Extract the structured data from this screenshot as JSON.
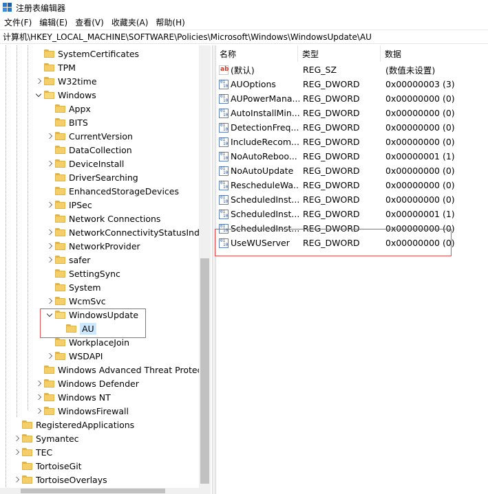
{
  "window": {
    "title": "注册表编辑器"
  },
  "menu": [
    "文件(F)",
    "编辑(E)",
    "查看(V)",
    "收藏夹(A)",
    "帮助(H)"
  ],
  "address": "计算机\\HKEY_LOCAL_MACHINE\\SOFTWARE\\Policies\\Microsoft\\Windows\\WindowsUpdate\\AU",
  "tree": [
    {
      "label": "SystemCertificates",
      "level": 2,
      "expander": "none"
    },
    {
      "label": "TPM",
      "level": 2,
      "expander": "none"
    },
    {
      "label": "W32time",
      "level": 2,
      "expander": "collapsed"
    },
    {
      "label": "Windows",
      "level": 2,
      "expander": "expanded"
    },
    {
      "label": "Appx",
      "level": 3,
      "expander": "none"
    },
    {
      "label": "BITS",
      "level": 3,
      "expander": "none"
    },
    {
      "label": "CurrentVersion",
      "level": 3,
      "expander": "collapsed"
    },
    {
      "label": "DataCollection",
      "level": 3,
      "expander": "none"
    },
    {
      "label": "DeviceInstall",
      "level": 3,
      "expander": "collapsed"
    },
    {
      "label": "DriverSearching",
      "level": 3,
      "expander": "none"
    },
    {
      "label": "EnhancedStorageDevices",
      "level": 3,
      "expander": "none"
    },
    {
      "label": "IPSec",
      "level": 3,
      "expander": "collapsed"
    },
    {
      "label": "Network Connections",
      "level": 3,
      "expander": "none"
    },
    {
      "label": "NetworkConnectivityStatusIndica",
      "level": 3,
      "expander": "collapsed"
    },
    {
      "label": "NetworkProvider",
      "level": 3,
      "expander": "collapsed"
    },
    {
      "label": "safer",
      "level": 3,
      "expander": "collapsed"
    },
    {
      "label": "SettingSync",
      "level": 3,
      "expander": "none"
    },
    {
      "label": "System",
      "level": 3,
      "expander": "none"
    },
    {
      "label": "WcmSvc",
      "level": 3,
      "expander": "collapsed"
    },
    {
      "label": "WindowsUpdate",
      "level": 3,
      "expander": "expanded"
    },
    {
      "label": "AU",
      "level": 4,
      "expander": "none",
      "selected": true
    },
    {
      "label": "WorkplaceJoin",
      "level": 3,
      "expander": "none"
    },
    {
      "label": "WSDAPI",
      "level": 3,
      "expander": "collapsed"
    },
    {
      "label": "Windows Advanced Threat Protectio",
      "level": 2,
      "expander": "none"
    },
    {
      "label": "Windows Defender",
      "level": 2,
      "expander": "collapsed"
    },
    {
      "label": "Windows NT",
      "level": 2,
      "expander": "collapsed"
    },
    {
      "label": "WindowsFirewall",
      "level": 2,
      "expander": "collapsed"
    },
    {
      "label": "RegisteredApplications",
      "level": 1,
      "expander": "none"
    },
    {
      "label": "Symantec",
      "level": 1,
      "expander": "collapsed"
    },
    {
      "label": "TEC",
      "level": 1,
      "expander": "collapsed"
    },
    {
      "label": "TortoiseGit",
      "level": 1,
      "expander": "none"
    },
    {
      "label": "TortoiseOverlays",
      "level": 1,
      "expander": "collapsed"
    }
  ],
  "columns": {
    "name": "名称",
    "type": "类型",
    "data": "数据"
  },
  "values": [
    {
      "name": "(默认)",
      "type": "REG_SZ",
      "data": "(数值未设置)",
      "icon": "string-value-icon"
    },
    {
      "name": "AUOptions",
      "type": "REG_DWORD",
      "data": "0x00000003 (3)",
      "icon": "dword-value-icon"
    },
    {
      "name": "AUPowerMana...",
      "type": "REG_DWORD",
      "data": "0x00000000 (0)",
      "icon": "dword-value-icon"
    },
    {
      "name": "AutoInstallMin...",
      "type": "REG_DWORD",
      "data": "0x00000000 (0)",
      "icon": "dword-value-icon"
    },
    {
      "name": "DetectionFreq...",
      "type": "REG_DWORD",
      "data": "0x00000000 (0)",
      "icon": "dword-value-icon"
    },
    {
      "name": "IncludeRecom...",
      "type": "REG_DWORD",
      "data": "0x00000000 (0)",
      "icon": "dword-value-icon"
    },
    {
      "name": "NoAutoReboo...",
      "type": "REG_DWORD",
      "data": "0x00000001 (1)",
      "icon": "dword-value-icon"
    },
    {
      "name": "NoAutoUpdate",
      "type": "REG_DWORD",
      "data": "0x00000000 (0)",
      "icon": "dword-value-icon"
    },
    {
      "name": "RescheduleWa...",
      "type": "REG_DWORD",
      "data": "0x00000000 (0)",
      "icon": "dword-value-icon"
    },
    {
      "name": "ScheduledInst...",
      "type": "REG_DWORD",
      "data": "0x00000000 (0)",
      "icon": "dword-value-icon"
    },
    {
      "name": "ScheduledInst...",
      "type": "REG_DWORD",
      "data": "0x00000001 (1)",
      "icon": "dword-value-icon"
    },
    {
      "name": "ScheduledInst...",
      "type": "REG_DWORD",
      "data": "0x00000000 (0)",
      "icon": "dword-value-icon"
    },
    {
      "name": "UseWUServer",
      "type": "REG_DWORD",
      "data": "0x00000000 (0)",
      "icon": "dword-value-icon"
    }
  ],
  "colors": {
    "highlight": "#e05050",
    "selection": "#cce8ff",
    "folder": "#f4cf69"
  }
}
